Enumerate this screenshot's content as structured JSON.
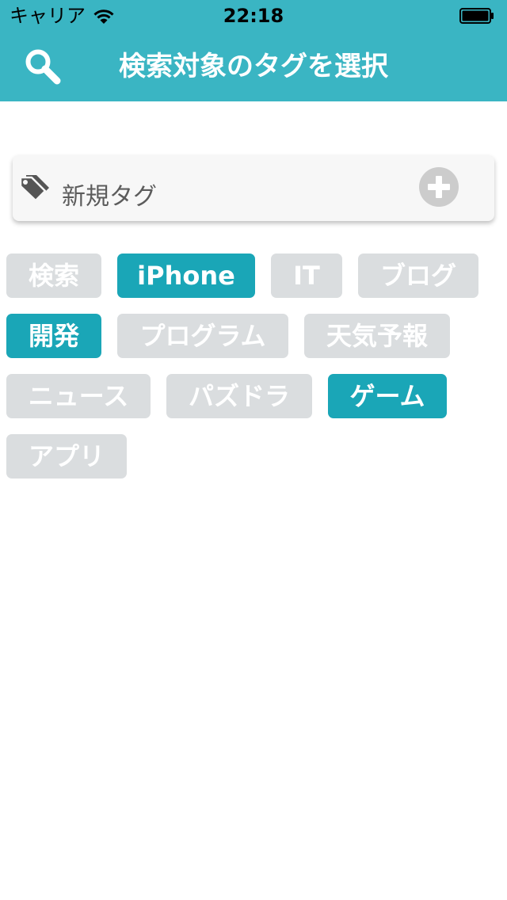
{
  "status_bar": {
    "carrier": "キャリア",
    "time": "22:18",
    "wifi_icon": "wifi-icon",
    "battery_icon": "battery-icon"
  },
  "nav": {
    "title": "検索対象のタグを選択",
    "search_icon": "search-icon",
    "background": "#3ab5c3"
  },
  "new_tag": {
    "placeholder": "新規タグ",
    "value": "",
    "tag_icon": "tags-icon",
    "add_icon": "plus-circle-icon"
  },
  "colors": {
    "accent": "#3ab5c3",
    "selected_chip": "#1aa6b7",
    "unselected_chip": "#dadddf",
    "chip_text": "#ffffff"
  },
  "tags": [
    {
      "label": "検索",
      "selected": false
    },
    {
      "label": "iPhone",
      "selected": true
    },
    {
      "label": "IT",
      "selected": false
    },
    {
      "label": "ブログ",
      "selected": false
    },
    {
      "label": "開発",
      "selected": true
    },
    {
      "label": "プログラム",
      "selected": false
    },
    {
      "label": "天気予報",
      "selected": false
    },
    {
      "label": "ニュース",
      "selected": false
    },
    {
      "label": "パズドラ",
      "selected": false
    },
    {
      "label": "ゲーム",
      "selected": true
    },
    {
      "label": "アプリ",
      "selected": false
    }
  ]
}
